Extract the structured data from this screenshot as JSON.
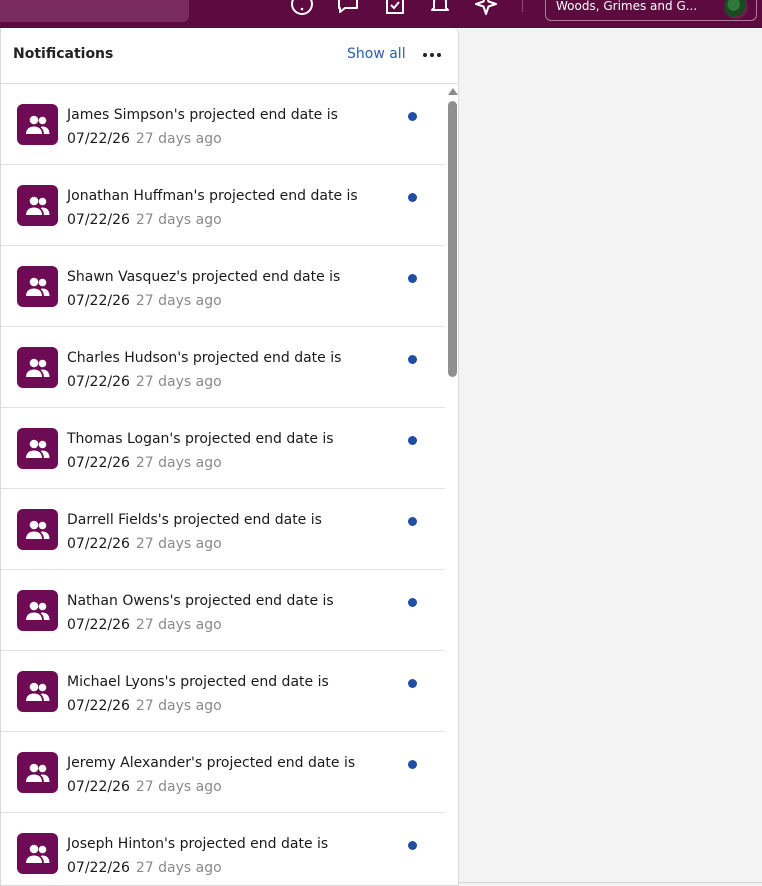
{
  "topbar": {
    "org_name": "Woods, Grimes and G..."
  },
  "panel": {
    "title": "Notifications",
    "show_all": "Show all"
  },
  "notifications": [
    {
      "message": "James Simpson's projected end date is",
      "date": "07/22/26",
      "ago": "27 days ago"
    },
    {
      "message": "Jonathan Huffman's projected end date is",
      "date": "07/22/26",
      "ago": "27 days ago"
    },
    {
      "message": "Shawn Vasquez's projected end date is",
      "date": "07/22/26",
      "ago": "27 days ago"
    },
    {
      "message": "Charles Hudson's projected end date is",
      "date": "07/22/26",
      "ago": "27 days ago"
    },
    {
      "message": "Thomas Logan's projected end date is",
      "date": "07/22/26",
      "ago": "27 days ago"
    },
    {
      "message": "Darrell Fields's projected end date is",
      "date": "07/22/26",
      "ago": "27 days ago"
    },
    {
      "message": "Nathan Owens's projected end date is",
      "date": "07/22/26",
      "ago": "27 days ago"
    },
    {
      "message": "Michael Lyons's projected end date is",
      "date": "07/22/26",
      "ago": "27 days ago"
    },
    {
      "message": "Jeremy Alexander's projected end date is",
      "date": "07/22/26",
      "ago": "27 days ago"
    },
    {
      "message": "Joseph Hinton's projected end date is",
      "date": "07/22/26",
      "ago": "27 days ago"
    }
  ],
  "colors": {
    "brand": "#5c0a40",
    "avatar_bg": "#6e0b55",
    "link": "#2a5ea8",
    "unread_dot": "#1f4ea3"
  }
}
